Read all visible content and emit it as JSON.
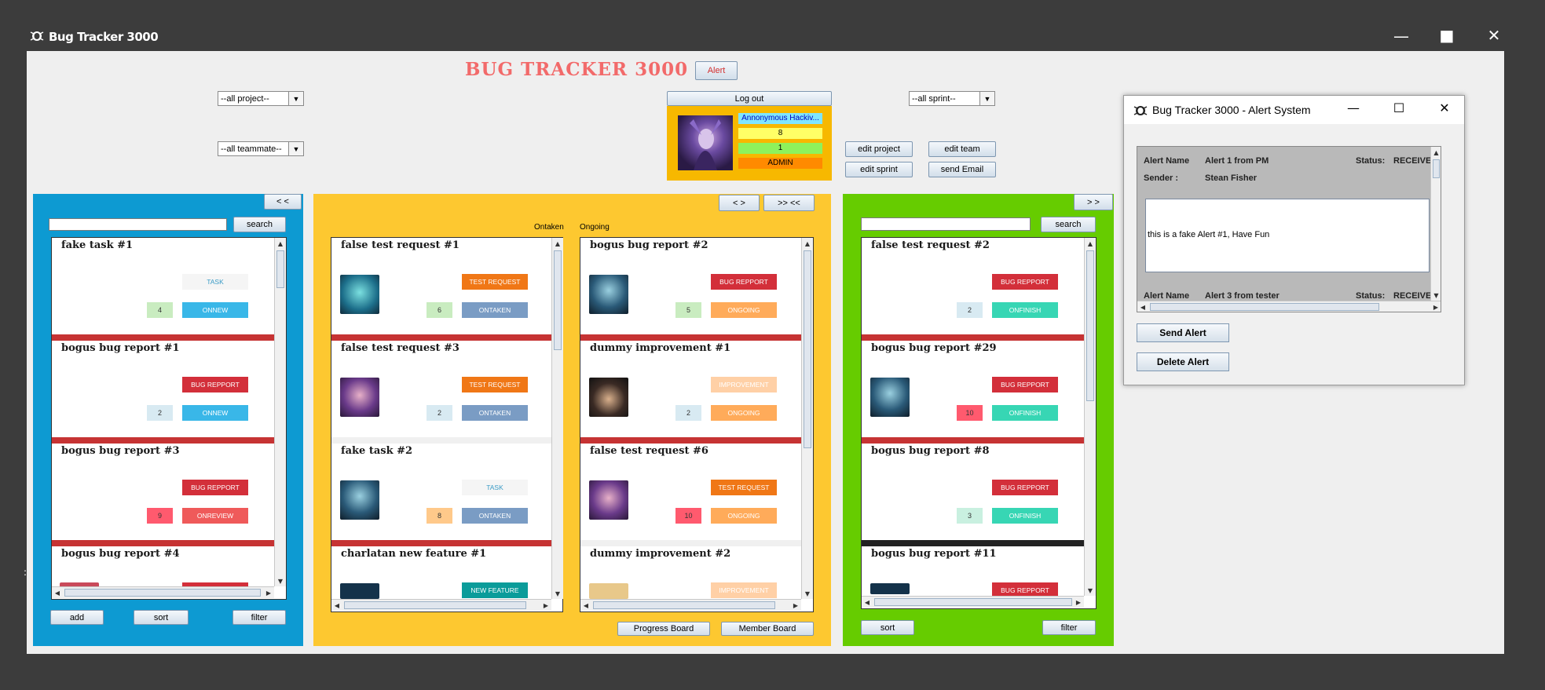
{
  "window": {
    "title": "Bug Tracker 3000",
    "minimize": "—",
    "maximize": "■",
    "close": "✕"
  },
  "header": {
    "app_title": "BUG TRACKER 3000",
    "alert_button": "Alert",
    "project_filter": "--all project--",
    "teammate_filter": "--all teammate--",
    "sprint_filter": "--all sprint--",
    "logout": "Log out",
    "edit_project": "edit project",
    "edit_team": "edit team",
    "edit_sprint": "edit sprint",
    "send_email": "send Email"
  },
  "user": {
    "name": "Annonymous Hackiv...",
    "count1": "8",
    "count2": "1",
    "role": "ADMIN"
  },
  "colors": {
    "backlog": "#0d9ad2",
    "progress": "#fdc830",
    "done": "#66cc00",
    "bug": "#d32f3a",
    "test": "#f07716",
    "improvement": "#ffd0a6",
    "task": "#f5f5f5",
    "feature": "#0b9c9a",
    "onnew": "#39b7e8",
    "ontaken": "#7a9cc4",
    "ongoing": "#ffab5a",
    "onfinish": "#37d6b4",
    "onreview": "#ef5a5a"
  },
  "backlog": {
    "collapse": "< <",
    "search": "search",
    "add": "add",
    "sort": "sort",
    "filter": "filter",
    "cards": [
      {
        "title": "fake task #1",
        "tag": "TASK",
        "num": "4",
        "status": "ONNEW"
      },
      {
        "title": "bogus bug report #1",
        "tag": "BUG REPPORT",
        "num": "2",
        "status": "ONNEW"
      },
      {
        "title": "bogus bug report #3",
        "tag": "BUG REPPORT",
        "num": "9",
        "status": "ONREVIEW"
      },
      {
        "title": "bogus bug report #4",
        "tag": "",
        "num": "",
        "status": ""
      }
    ]
  },
  "progress": {
    "toggle": "< >",
    "expand": ">> <<",
    "ontaken_label": "Ontaken",
    "ongoing_label": "Ongoing",
    "progress_board": "Progress Board",
    "member_board": "Member Board",
    "taken": [
      {
        "title": "false test request #1",
        "tag": "TEST REQUEST",
        "num": "6",
        "status": "ONTAKEN"
      },
      {
        "title": "false test request #3",
        "tag": "TEST REQUEST",
        "num": "2",
        "status": "ONTAKEN"
      },
      {
        "title": "fake task #2",
        "tag": "TASK",
        "num": "8",
        "status": "ONTAKEN"
      },
      {
        "title": "charlatan new feature #1",
        "tag": "NEW FEATURE",
        "num": "",
        "status": ""
      }
    ],
    "going": [
      {
        "title": "bogus bug report #2",
        "tag": "BUG REPPORT",
        "num": "5",
        "status": "ONGOING"
      },
      {
        "title": "dummy improvement #1",
        "tag": "IMPROVEMENT",
        "num": "2",
        "status": "ONGOING"
      },
      {
        "title": "false test request #6",
        "tag": "TEST REQUEST",
        "num": "10",
        "status": "ONGOING"
      },
      {
        "title": "dummy improvement #2",
        "tag": "IMPROVEMENT",
        "num": "",
        "status": ""
      }
    ]
  },
  "done": {
    "expand": "> >",
    "search": "search",
    "sort": "sort",
    "filter": "filter",
    "cards": [
      {
        "title": "false test request #2",
        "tag": "BUG REPPORT",
        "num": "2",
        "status": "ONFINISH"
      },
      {
        "title": "bogus bug report #29",
        "tag": "BUG REPPORT",
        "num": "10",
        "status": "ONFINISH"
      },
      {
        "title": "bogus bug report #8",
        "tag": "BUG REPPORT",
        "num": "3",
        "status": "ONFINISH"
      },
      {
        "title": "bogus bug report #11",
        "tag": "BUG REPPORT",
        "num": "",
        "status": ""
      }
    ]
  },
  "alert_window": {
    "title": "Bug Tracker 3000 - Alert System",
    "alert_name_label": "Alert Name",
    "alert_name": "Alert 1 from PM",
    "status_label": "Status:",
    "status": "RECEIVE",
    "sender_label": "Sender :",
    "sender": "Stean Fisher",
    "message": "this is a fake Alert #1, Have Fun",
    "next_alert_name": "Alert 3 from tester",
    "next_status": "RECEIVE",
    "send_alert": "Send Alert",
    "delete_alert": "Delete Alert"
  }
}
